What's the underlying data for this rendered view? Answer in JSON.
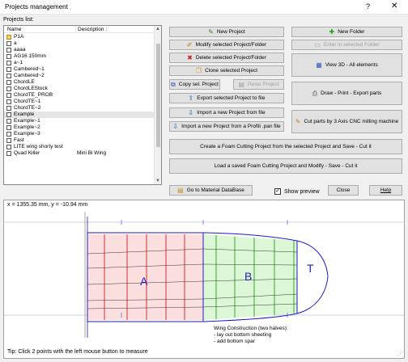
{
  "window": {
    "title": "Projects management",
    "help_glyph": "?",
    "close_glyph": "✕"
  },
  "projects": {
    "label": "Projects list:",
    "columns": [
      "Name",
      "Description :"
    ],
    "items": [
      {
        "name": "P1A",
        "desc": "",
        "kind": "folder"
      },
      {
        "name": "a",
        "desc": "",
        "kind": "project"
      },
      {
        "name": "aaaa",
        "desc": "",
        "kind": "project"
      },
      {
        "name": "AG16 150mm",
        "desc": "",
        "kind": "project"
      },
      {
        "name": "a~1",
        "desc": "",
        "kind": "project"
      },
      {
        "name": "Cambered~1",
        "desc": "",
        "kind": "project"
      },
      {
        "name": "Cambered~2",
        "desc": "",
        "kind": "project"
      },
      {
        "name": "ChordLE",
        "desc": "",
        "kind": "project"
      },
      {
        "name": "ChordLEStock",
        "desc": "",
        "kind": "project"
      },
      {
        "name": "ChordTE_PROB",
        "desc": "",
        "kind": "project"
      },
      {
        "name": "ChordTE~1",
        "desc": "",
        "kind": "project"
      },
      {
        "name": "ChordTE~2",
        "desc": "",
        "kind": "project"
      },
      {
        "name": "Example",
        "desc": "",
        "kind": "project",
        "selected": true
      },
      {
        "name": "Example~1",
        "desc": "",
        "kind": "project"
      },
      {
        "name": "Example~2",
        "desc": "",
        "kind": "project"
      },
      {
        "name": "Example~3",
        "desc": "",
        "kind": "project"
      },
      {
        "name": "Fast",
        "desc": "",
        "kind": "project"
      },
      {
        "name": "LITE wing shorty test",
        "desc": "",
        "kind": "project"
      },
      {
        "name": "Quad Killer",
        "desc": "Mini Bi Wing",
        "kind": "project"
      }
    ]
  },
  "buttons": {
    "new_project": "New Project",
    "modify_project": "Modify selected Project/Folder",
    "delete_project": "Delete selected Project/Folder",
    "clone_project": "Clone selected Project",
    "copy_project": "Copy sel. Project",
    "paste_project": "Paste Project",
    "export_project": "Export selected Project to file",
    "import_project": "Import a new Project from file",
    "import_profili": "Import a new Project from a Profili .pan file",
    "new_folder": "New Folder",
    "enter_folder": "Enter in selected Folder",
    "view_3d": "View 3D - All elements",
    "draw_print": "Draw - Print - Export parts",
    "cut_cnc": "Cut parts by 3 Axis CNC milling machine",
    "foam_create": "Create a Foam Cutting Project from the selected Project and Save - Cut it",
    "foam_load": "Load a saved Foam Cutting Project and Modify - Save - Cut it",
    "material_db": "Go to Material DataBase",
    "show_preview": "Show preview",
    "close": "Close",
    "help": "Help"
  },
  "preview": {
    "coords": "x = 1355.35 mm, y = -10.94 mm",
    "section_labels": [
      "A",
      "B",
      "T"
    ],
    "note": "Wing Construction (two halves):\n- lay out bottom sheeting\n- add bottom spar",
    "tip": "Tip: Click 2 points with the left mouse button to measure",
    "colors": {
      "section_a": "#fbdede",
      "section_b": "#dcf7d6",
      "outline": "#1a1ad0",
      "rib_a": "#d02020",
      "rib_b": "#2a9a2a",
      "label": "#2020c0"
    }
  }
}
